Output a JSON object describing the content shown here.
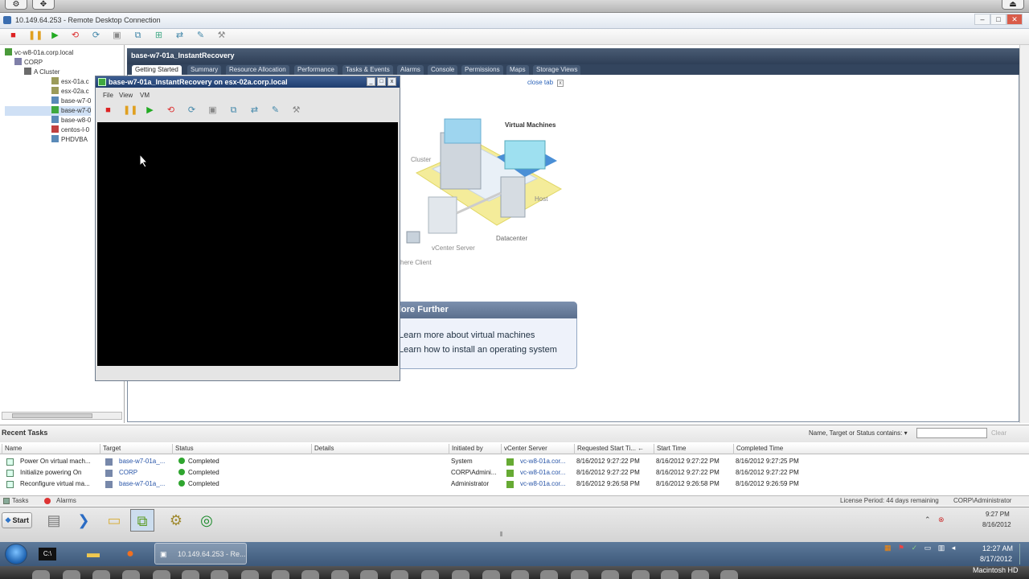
{
  "rdp": {
    "title": "10.149.64.253 - Remote Desktop Connection"
  },
  "tree": {
    "items": [
      {
        "label": "vc-w8-01a.corp.local",
        "depth": 0,
        "color": "#4a9a3a"
      },
      {
        "label": "CORP",
        "depth": 1,
        "color": "#7f7fa8"
      },
      {
        "label": "A Cluster",
        "depth": 2,
        "color": "#6b6b6b"
      },
      {
        "label": "esx-01a.c",
        "depth": 3,
        "color": "#9b9b5a"
      },
      {
        "label": "esx-02a.c",
        "depth": 3,
        "color": "#9b9b5a"
      },
      {
        "label": "base-w7-0",
        "depth": 3,
        "color": "#5a8ab8"
      },
      {
        "label": "base-w7-0",
        "depth": 3,
        "color": "#3fa83f"
      },
      {
        "label": "base-w8-0",
        "depth": 3,
        "color": "#5a8ab8"
      },
      {
        "label": "centos-l-0",
        "depth": 3,
        "color": "#c04040"
      },
      {
        "label": "PHDVBA",
        "depth": 3,
        "color": "#5a8ab8"
      }
    ]
  },
  "main": {
    "title": "base-w7-01a_InstantRecovery",
    "tabs": [
      "Getting Started",
      "Summary",
      "Resource Allocation",
      "Performance",
      "Tasks & Events",
      "Alarms",
      "Console",
      "Permissions",
      "Maps",
      "Storage Views"
    ],
    "close_tab": "close tab",
    "diagram": {
      "virtual_machines": "Virtual Machines",
      "cluster": "Cluster",
      "host": "Host",
      "datacenter": "Datacenter",
      "vcenter_server": "vCenter Server",
      "client": "here Client"
    },
    "explore": {
      "title": "lore Further",
      "link1": "Learn more about virtual machines",
      "link2": "Learn how to install an operating system"
    }
  },
  "vm_console": {
    "title": "base-w7-01a_InstantRecovery on esx-02a.corp.local",
    "menu": [
      "File",
      "View",
      "VM"
    ]
  },
  "recent_tasks": {
    "title": "Recent Tasks",
    "filter_label": "Name, Target or Status contains: ▾",
    "filter_value": "",
    "clear": "Clear",
    "columns": [
      "Name",
      "Target",
      "Status",
      "Details",
      "Initiated by",
      "vCenter Server",
      "Requested Start Ti... ←",
      "Start Time",
      "Completed Time"
    ],
    "rows": [
      {
        "name": "Power On virtual mach...",
        "target": "base-w7-01a_...",
        "status": "Completed",
        "initiated": "System",
        "vcenter": "vc-w8-01a.cor...",
        "requested": "8/16/2012 9:27:22 PM",
        "start": "8/16/2012 9:27:22 PM",
        "completed": "8/16/2012 9:27:25 PM"
      },
      {
        "name": "Initialize powering On",
        "target": "CORP",
        "status": "Completed",
        "initiated": "CORP\\Admini...",
        "vcenter": "vc-w8-01a.cor...",
        "requested": "8/16/2012 9:27:22 PM",
        "start": "8/16/2012 9:27:22 PM",
        "completed": "8/16/2012 9:27:22 PM"
      },
      {
        "name": "Reconfigure virtual ma...",
        "target": "base-w7-01a_...",
        "status": "Completed",
        "initiated": "Administrator",
        "vcenter": "vc-w8-01a.cor...",
        "requested": "8/16/2012 9:26:58 PM",
        "start": "8/16/2012 9:26:58 PM",
        "completed": "8/16/2012 9:26:59 PM"
      }
    ]
  },
  "statusbar": {
    "tasks": "Tasks",
    "alarms": "Alarms",
    "license": "License Period: 44 days remaining",
    "user": "CORP\\Administrator"
  },
  "xp_taskbar": {
    "start": "Start",
    "time": "9:27 PM",
    "date": "8/16/2012"
  },
  "w7_taskbar": {
    "active_label": "10.149.64.253 - Re...",
    "time": "12:27 AM",
    "date": "8/17/2012"
  },
  "mac": {
    "disk": "Macintosh HD"
  }
}
